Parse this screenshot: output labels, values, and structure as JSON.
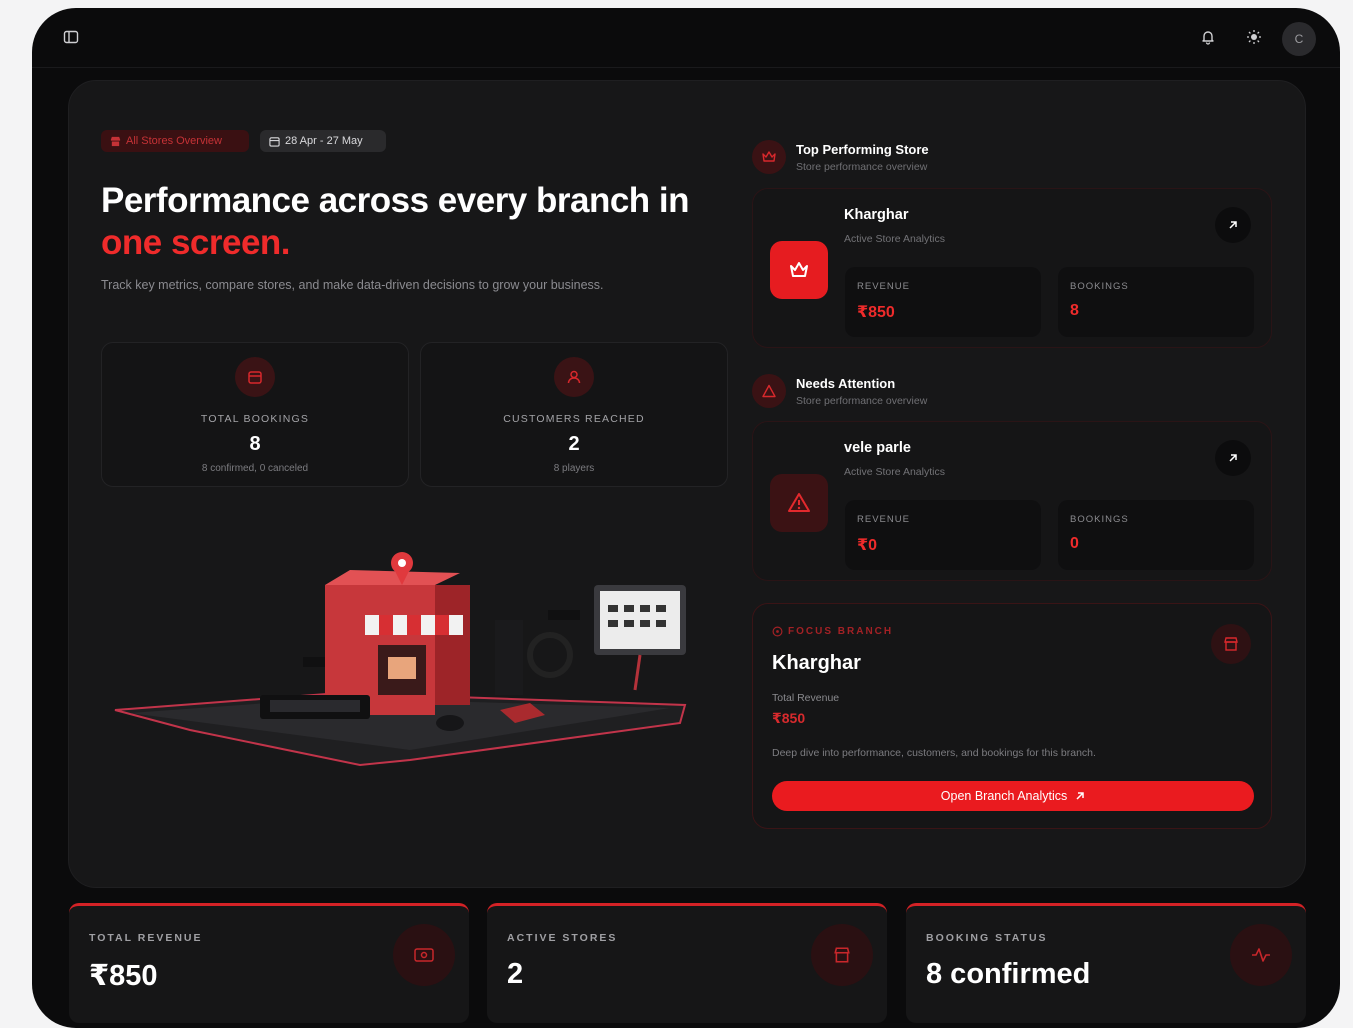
{
  "topbar": {
    "sidebar_toggle_icon": "sidebar-panel-icon",
    "notification_icon": "bell-icon",
    "theme_icon": "sun-icon",
    "avatar_initial": "C"
  },
  "hero": {
    "tag_label": "All Stores Overview",
    "date_range": "28 Apr - 27 May",
    "headline_main": "Performance across every branch in",
    "headline_accent": "one screen.",
    "subtitle": "Track key metrics, compare stores, and make data-driven decisions to grow your business."
  },
  "stats": [
    {
      "label": "TOTAL BOOKINGS",
      "value": "8",
      "sub": "8 confirmed, 0 canceled",
      "icon": "calendar-icon"
    },
    {
      "label": "CUSTOMERS REACHED",
      "value": "2",
      "sub": "8 players",
      "icon": "user-icon"
    }
  ],
  "top_store": {
    "section_title": "Top Performing Store",
    "section_sub": "Store performance overview",
    "name": "Kharghar",
    "sub": "Active Store Analytics",
    "revenue_label": "REVENUE",
    "revenue_value": "₹850",
    "bookings_label": "BOOKINGS",
    "bookings_value": "8"
  },
  "attention_store": {
    "section_title": "Needs Attention",
    "section_sub": "Store performance overview",
    "name": "vele parle",
    "sub": "Active Store Analytics",
    "revenue_label": "REVENUE",
    "revenue_value": "₹0",
    "bookings_label": "BOOKINGS",
    "bookings_value": "0"
  },
  "focus": {
    "label": "FOCUS BRANCH",
    "name": "Kharghar",
    "total_revenue_label": "Total Revenue",
    "total_revenue_value": "₹850",
    "description": "Deep dive into performance, customers, and bookings for this branch.",
    "button_label": "Open Branch Analytics"
  },
  "bottom": [
    {
      "label": "TOTAL REVENUE",
      "value": "₹850",
      "icon": "cash-icon"
    },
    {
      "label": "ACTIVE STORES",
      "value": "2",
      "icon": "store-icon"
    },
    {
      "label": "BOOKING STATUS",
      "value": "8 confirmed",
      "icon": "activity-icon"
    }
  ],
  "colors": {
    "accent": "#ef2b2b",
    "background": "#0b0b0c",
    "panel": "#171718"
  }
}
